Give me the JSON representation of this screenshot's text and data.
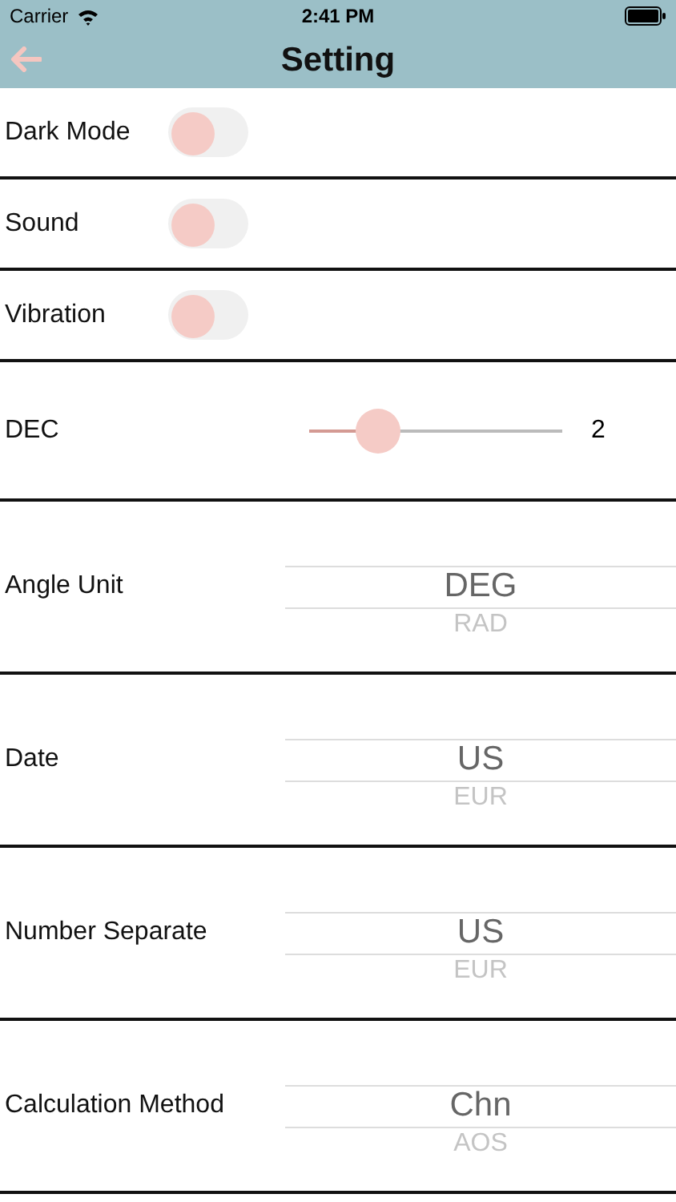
{
  "status_bar": {
    "carrier": "Carrier",
    "time": "2:41 PM"
  },
  "nav": {
    "title": "Setting"
  },
  "rows": [
    {
      "kind": "toggle",
      "label": "Dark Mode",
      "on": false
    },
    {
      "kind": "toggle",
      "label": "Sound",
      "on": false
    },
    {
      "kind": "toggle",
      "label": "Vibration",
      "on": false
    },
    {
      "kind": "slider",
      "label": "DEC",
      "level": 0.27,
      "reading": "2"
    },
    {
      "kind": "picker",
      "label": "Angle Unit",
      "options": [
        {
          "label": "DEG",
          "selected": true
        },
        {
          "label": "RAD",
          "selected": false
        }
      ]
    },
    {
      "kind": "picker",
      "label": "Date",
      "options": [
        {
          "label": "US",
          "selected": true
        },
        {
          "label": "EUR",
          "selected": false
        }
      ]
    },
    {
      "kind": "picker",
      "label": "Number Separate",
      "options": [
        {
          "label": "US",
          "selected": true
        },
        {
          "label": "EUR",
          "selected": false
        }
      ]
    },
    {
      "kind": "picker",
      "label": "Calculation Method",
      "options": [
        {
          "label": "Chn",
          "selected": true
        },
        {
          "label": "AOS",
          "selected": false
        }
      ]
    }
  ]
}
